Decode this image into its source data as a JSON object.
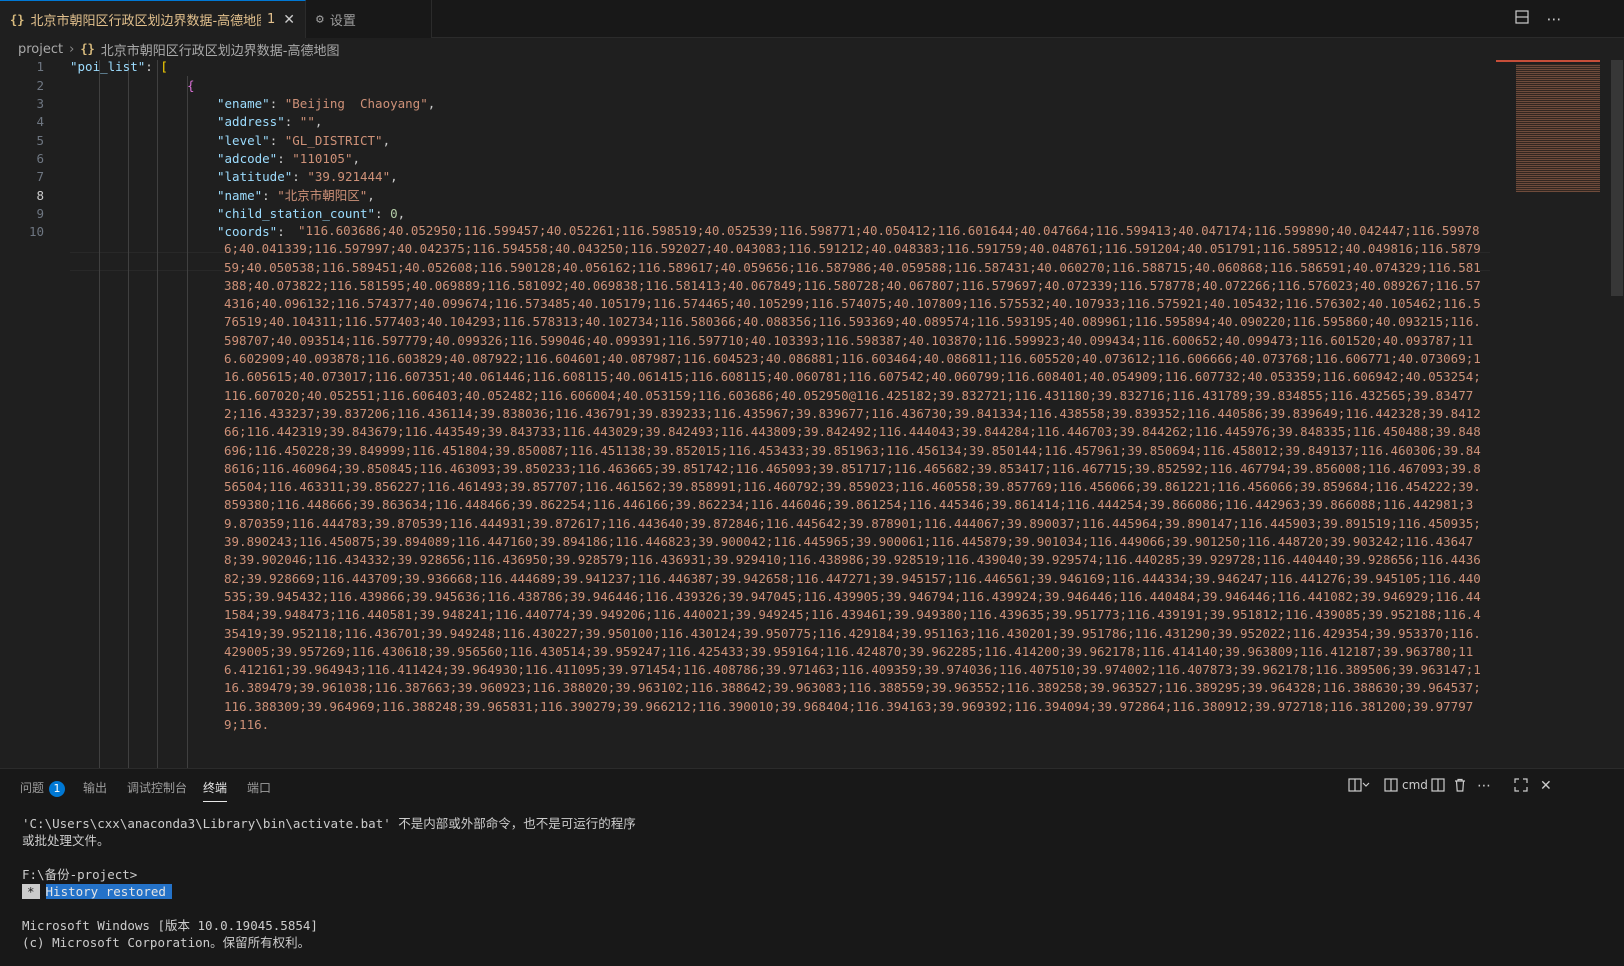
{
  "tabs": [
    {
      "icon": "{}",
      "label": "北京市朝阳区行政区划边界数据-高德地图",
      "badge": "1",
      "close": "✕"
    },
    {
      "icon": "⚙",
      "label": "设置"
    }
  ],
  "breadcrumb": {
    "root": "project",
    "icon": "{}",
    "file": "北京市朝阳区行政区划边界数据-高德地图"
  },
  "editor": {
    "line_numbers": [
      "1",
      "2",
      "3",
      "4",
      "5",
      "6",
      "7",
      "8",
      "9",
      "10"
    ],
    "active_line": "8",
    "lines": {
      "l1_key": "\"poi_list\"",
      "l1_colon": ": ",
      "l1_brk": "[",
      "l2_brk": "{",
      "l3_key": "\"ename\"",
      "l3_val": "\"Beijing  Chaoyang\"",
      "l4_key": "\"address\"",
      "l4_val": "\"\"",
      "l5_key": "\"level\"",
      "l5_val": "\"GL_DISTRICT\"",
      "l6_key": "\"adcode\"",
      "l6_val": "\"110105\"",
      "l7_key": "\"latitude\"",
      "l7_val": "\"39.921444\"",
      "l8_key": "\"name\"",
      "l8_val": "\"北京市朝阳区\"",
      "l9_key": "\"child_station_count\"",
      "l9_val": "0",
      "l10_key": "\"coords\""
    },
    "coords": "\"116.603686;40.052950;116.599457;40.052261;116.598519;40.052539;116.598771;40.050412;116.601644;40.047664;116.599413;40.047174;116.599890;40.042447;116.599786;40.041339;116.597997;40.042375;116.594558;40.043250;116.592027;40.043083;116.591212;40.048383;116.591759;40.048761;116.591204;40.051791;116.589512;40.049816;116.587959;40.050538;116.589451;40.052608;116.590128;40.056162;116.589617;40.059656;116.587986;40.059588;116.587431;40.060270;116.588715;40.060868;116.586591;40.074329;116.581388;40.073822;116.581595;40.069889;116.581092;40.069838;116.581413;40.067849;116.580728;40.067807;116.579697;40.072339;116.578778;40.072266;116.576023;40.089267;116.574316;40.096132;116.574377;40.099674;116.573485;40.105179;116.574465;40.105299;116.574075;40.107809;116.575532;40.107933;116.575921;40.105432;116.576302;40.105462;116.576519;40.104311;116.577403;40.104293;116.578313;40.102734;116.580366;40.088356;116.593369;40.089574;116.593195;40.089961;116.595894;40.090220;116.595860;40.093215;116.598707;40.093514;116.597779;40.099326;116.599046;40.099391;116.597710;40.103393;116.598387;40.103870;116.599923;40.099434;116.600652;40.099473;116.601520;40.093787;116.602909;40.093878;116.603829;40.087922;116.604601;40.087987;116.604523;40.086881;116.603464;40.086811;116.605520;40.073612;116.606666;40.073768;116.606771;40.073069;116.605615;40.073017;116.607351;40.061446;116.608115;40.061415;116.608115;40.060781;116.607542;40.060799;116.608401;40.054909;116.607732;40.053359;116.606942;40.053254;116.607020;40.052551;116.606403;40.052482;116.606004;40.053159;116.603686;40.052950@116.425182;39.832721;116.431180;39.832716;116.431789;39.834855;116.432565;39.834772;116.433237;39.837206;116.436114;39.838036;116.436791;39.839233;116.435967;39.839677;116.436730;39.841334;116.438558;39.839352;116.440586;39.839649;116.442328;39.841266;116.442319;39.843679;116.443549;39.843733;116.443029;39.842493;116.443809;39.842492;116.444043;39.844284;116.446703;39.844262;116.445976;39.848335;116.450488;39.848696;116.450228;39.849999;116.451804;39.850087;116.451138;39.852015;116.453433;39.851963;116.456134;39.850144;116.457961;39.850694;116.458012;39.849137;116.460306;39.848616;116.460964;39.850845;116.463093;39.850233;116.463665;39.851742;116.465093;39.851717;116.465682;39.853417;116.467715;39.852592;116.467794;39.856008;116.467093;39.856504;116.463311;39.856227;116.461493;39.857707;116.461562;39.858991;116.460792;39.859023;116.460558;39.857769;116.456066;39.861221;116.456066;39.859684;116.454222;39.859380;116.448666;39.863634;116.448466;39.862254;116.446166;39.862234;116.446046;39.861254;116.445346;39.861414;116.444254;39.866086;116.442963;39.866088;116.442981;39.870359;116.444783;39.870539;116.444931;39.872617;116.443640;39.872846;116.445642;39.878901;116.444067;39.890037;116.445964;39.890147;116.445903;39.891519;116.450935;39.890243;116.450875;39.894089;116.447160;39.894186;116.446823;39.900042;116.445965;39.900061;116.445879;39.901034;116.449066;39.901250;116.448720;39.903242;116.436478;39.902046;116.434332;39.928656;116.436950;39.928579;116.436931;39.929410;116.438986;39.928519;116.439040;39.929574;116.440285;39.929728;116.440440;39.928656;116.443682;39.928669;116.443709;39.936668;116.444689;39.941237;116.446387;39.942658;116.447271;39.945157;116.446561;39.946169;116.444334;39.946247;116.441276;39.945105;116.440535;39.945432;116.439866;39.945636;116.438786;39.946446;116.439326;39.947045;116.439905;39.946794;116.439924;39.946446;116.440484;39.946446;116.441082;39.946929;116.441584;39.948473;116.440581;39.948241;116.440774;39.949206;116.440021;39.949245;116.439461;39.949380;116.439635;39.951773;116.439191;39.951812;116.439085;39.952188;116.435419;39.952118;116.436701;39.949248;116.430227;39.950100;116.430124;39.950775;116.429184;39.951163;116.430201;39.951786;116.431290;39.952022;116.429354;39.953370;116.429005;39.957269;116.430618;39.956560;116.430514;39.959247;116.425433;39.959164;116.424870;39.962285;116.414200;39.962178;116.414140;39.963809;116.412187;39.963780;116.412161;39.964943;116.411424;39.964930;116.411095;39.971454;116.408786;39.971463;116.409359;39.974036;116.407510;39.974002;116.407873;39.962178;116.389506;39.963147;116.389479;39.961038;116.387663;39.960923;116.388020;39.963102;116.388642;39.963083;116.388559;39.963552;116.389258;39.963527;116.389295;39.964328;116.388630;39.964537;116.388309;39.964969;116.388248;39.965831;116.390279;39.966212;116.390010;39.968404;116.394163;39.969392;116.394094;39.972864;116.380912;39.972718;116.381200;39.977979;116."
  },
  "panel": {
    "tabs": [
      {
        "label": "问题",
        "badge": "1"
      },
      {
        "label": "输出"
      },
      {
        "label": "调试控制台"
      },
      {
        "label": "终端"
      },
      {
        "label": "端口"
      }
    ],
    "terminal_profile": "cmd",
    "terminal": {
      "line1": "'C:\\Users\\cxx\\anaconda3\\Library\\bin\\activate.bat' 不是内部或外部命令，也不是可运行的程序",
      "line2": "或批处理文件。",
      "prompt": "F:\\备份-project>",
      "restored_star": "*",
      "restored_text": "History restored",
      "line5": "Microsoft Windows [版本 10.0.19045.5854]",
      "line6": "(c) Microsoft Corporation。保留所有权利。"
    }
  }
}
